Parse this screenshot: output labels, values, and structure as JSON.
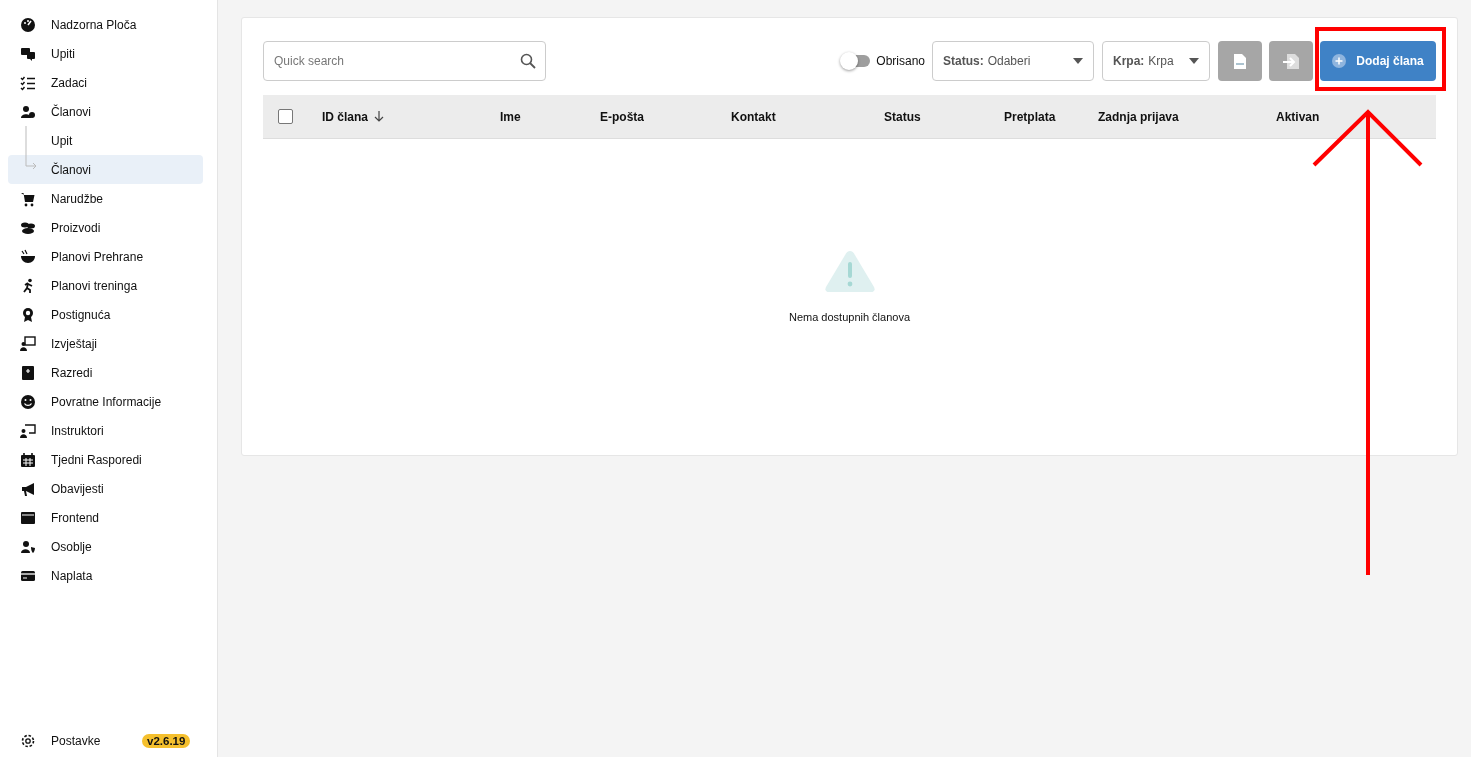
{
  "sidebar": {
    "items": [
      {
        "label": "Nadzorna Ploča",
        "selected": false
      },
      {
        "label": "Upiti",
        "selected": false
      },
      {
        "label": "Zadaci",
        "selected": false
      },
      {
        "label": "Članovi",
        "selected": false,
        "children": [
          {
            "label": "Upit",
            "selected": false
          },
          {
            "label": "Članovi",
            "selected": true
          }
        ]
      },
      {
        "label": "Narudžbe",
        "selected": false
      },
      {
        "label": "Proizvodi",
        "selected": false
      },
      {
        "label": "Planovi Prehrane",
        "selected": false
      },
      {
        "label": "Planovi treninga",
        "selected": false
      },
      {
        "label": "Postignuća",
        "selected": false
      },
      {
        "label": "Izvještaji",
        "selected": false
      },
      {
        "label": "Razredi",
        "selected": false
      },
      {
        "label": "Povratne Informacije",
        "selected": false
      },
      {
        "label": "Instruktori",
        "selected": false
      },
      {
        "label": "Tjedni Rasporedi",
        "selected": false
      },
      {
        "label": "Obavijesti",
        "selected": false
      },
      {
        "label": "Frontend",
        "selected": false
      },
      {
        "label": "Osoblje",
        "selected": false
      },
      {
        "label": "Naplata",
        "selected": false
      }
    ],
    "footer": {
      "label": "Postavke",
      "version": "v2.6.19"
    }
  },
  "toolbar": {
    "search": {
      "placeholder": "Quick search"
    },
    "toggle": {
      "label": "Obrisano",
      "on": false
    },
    "filters": [
      {
        "label": "Status:",
        "value": "Odaberi"
      },
      {
        "label": "Krpa:",
        "value": "Krpa"
      }
    ],
    "icon_buttons": [
      {
        "kind": "csv",
        "disabled": true
      },
      {
        "kind": "import",
        "disabled": true
      }
    ],
    "add_button": {
      "label": "Dodaj člana"
    }
  },
  "table": {
    "select_all": {
      "checked": false
    },
    "columns": [
      {
        "label": "ID člana",
        "sorted": true
      },
      {
        "label": "Ime",
        "sorted": false
      },
      {
        "label": "E-pošta",
        "sorted": false
      },
      {
        "label": "Kontakt",
        "sorted": false
      },
      {
        "label": "Status",
        "sorted": false
      },
      {
        "label": "Pretplata",
        "sorted": false
      },
      {
        "label": "Zadnja prijava",
        "sorted": false
      },
      {
        "label": "Aktivan",
        "sorted": false
      }
    ],
    "empty_message": "Nema dostupnih članova"
  }
}
